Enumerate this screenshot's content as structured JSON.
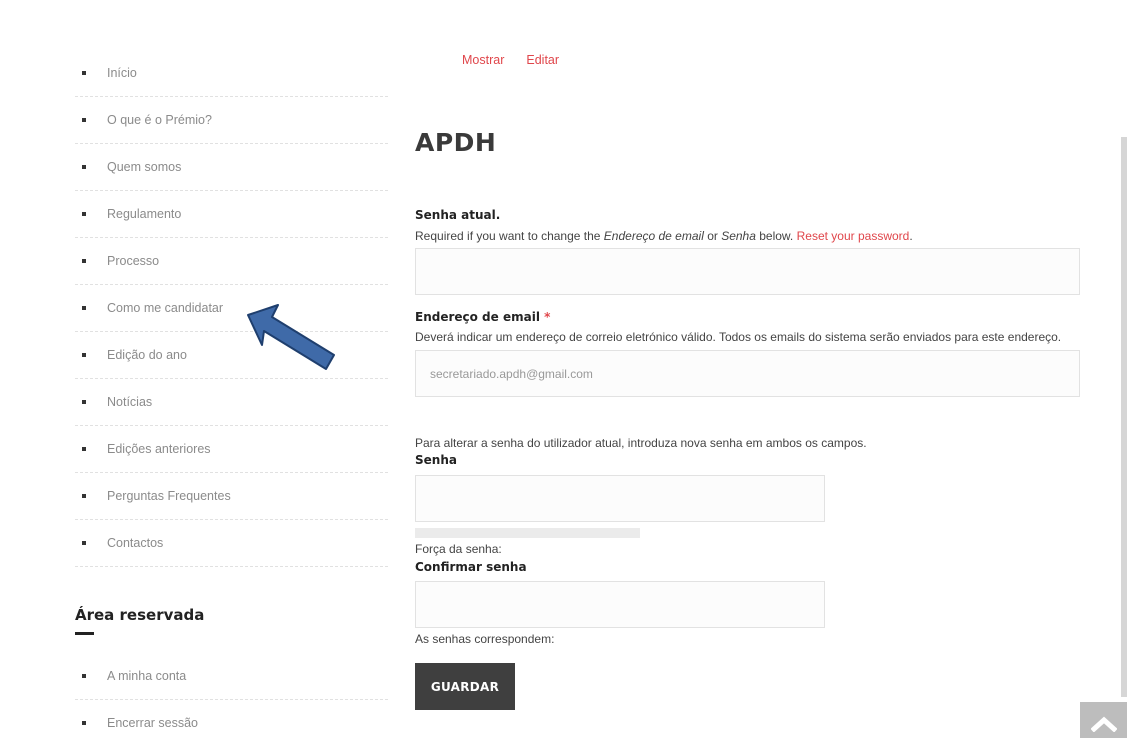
{
  "sidebar": {
    "menu": [
      {
        "label": "Início"
      },
      {
        "label": "O que é o Prémio?"
      },
      {
        "label": "Quem somos"
      },
      {
        "label": "Regulamento"
      },
      {
        "label": "Processo"
      },
      {
        "label": "Como me candidatar"
      },
      {
        "label": "Edição do ano"
      },
      {
        "label": "Notícias"
      },
      {
        "label": "Edições anteriores"
      },
      {
        "label": "Perguntas Frequentes"
      },
      {
        "label": "Contactos"
      }
    ],
    "area_title": "Área reservada",
    "area_menu": [
      {
        "label": "A minha conta"
      },
      {
        "label": "Encerrar sessão"
      }
    ]
  },
  "tabs": {
    "show": "Mostrar",
    "edit": "Editar"
  },
  "page_title": "APDH",
  "current_password": {
    "label": "Senha atual.",
    "desc_prefix": "Required if you want to change the ",
    "desc_em1": "Endereço de email",
    "desc_mid": " or ",
    "desc_em2": "Senha",
    "desc_suffix": " below. ",
    "reset_link": "Reset your password",
    "desc_end": ".",
    "value": ""
  },
  "email": {
    "label": "Endereço de email",
    "required_mark": "*",
    "desc": "Deverá indicar um endereço de correio eletrónico válido. Todos os emails do sistema serão enviados para este endereço.",
    "value": "secretariado.apdh@gmail.com"
  },
  "password": {
    "intro": "Para alterar a senha do utilizador atual, introduza nova senha em ambos os campos.",
    "label": "Senha",
    "value": "",
    "strength_label": "Força da senha:"
  },
  "confirm": {
    "label": "Confirmar senha",
    "value": "",
    "match_label": "As senhas correspondem:"
  },
  "save_button": "GUARDAR",
  "colors": {
    "accent": "#e0464b",
    "button": "#3f3f3f",
    "annotation_arrow": "#3f6aa8"
  },
  "icons": {
    "scroll_top": "chevron-up-icon",
    "annotation": "arrow-icon"
  }
}
